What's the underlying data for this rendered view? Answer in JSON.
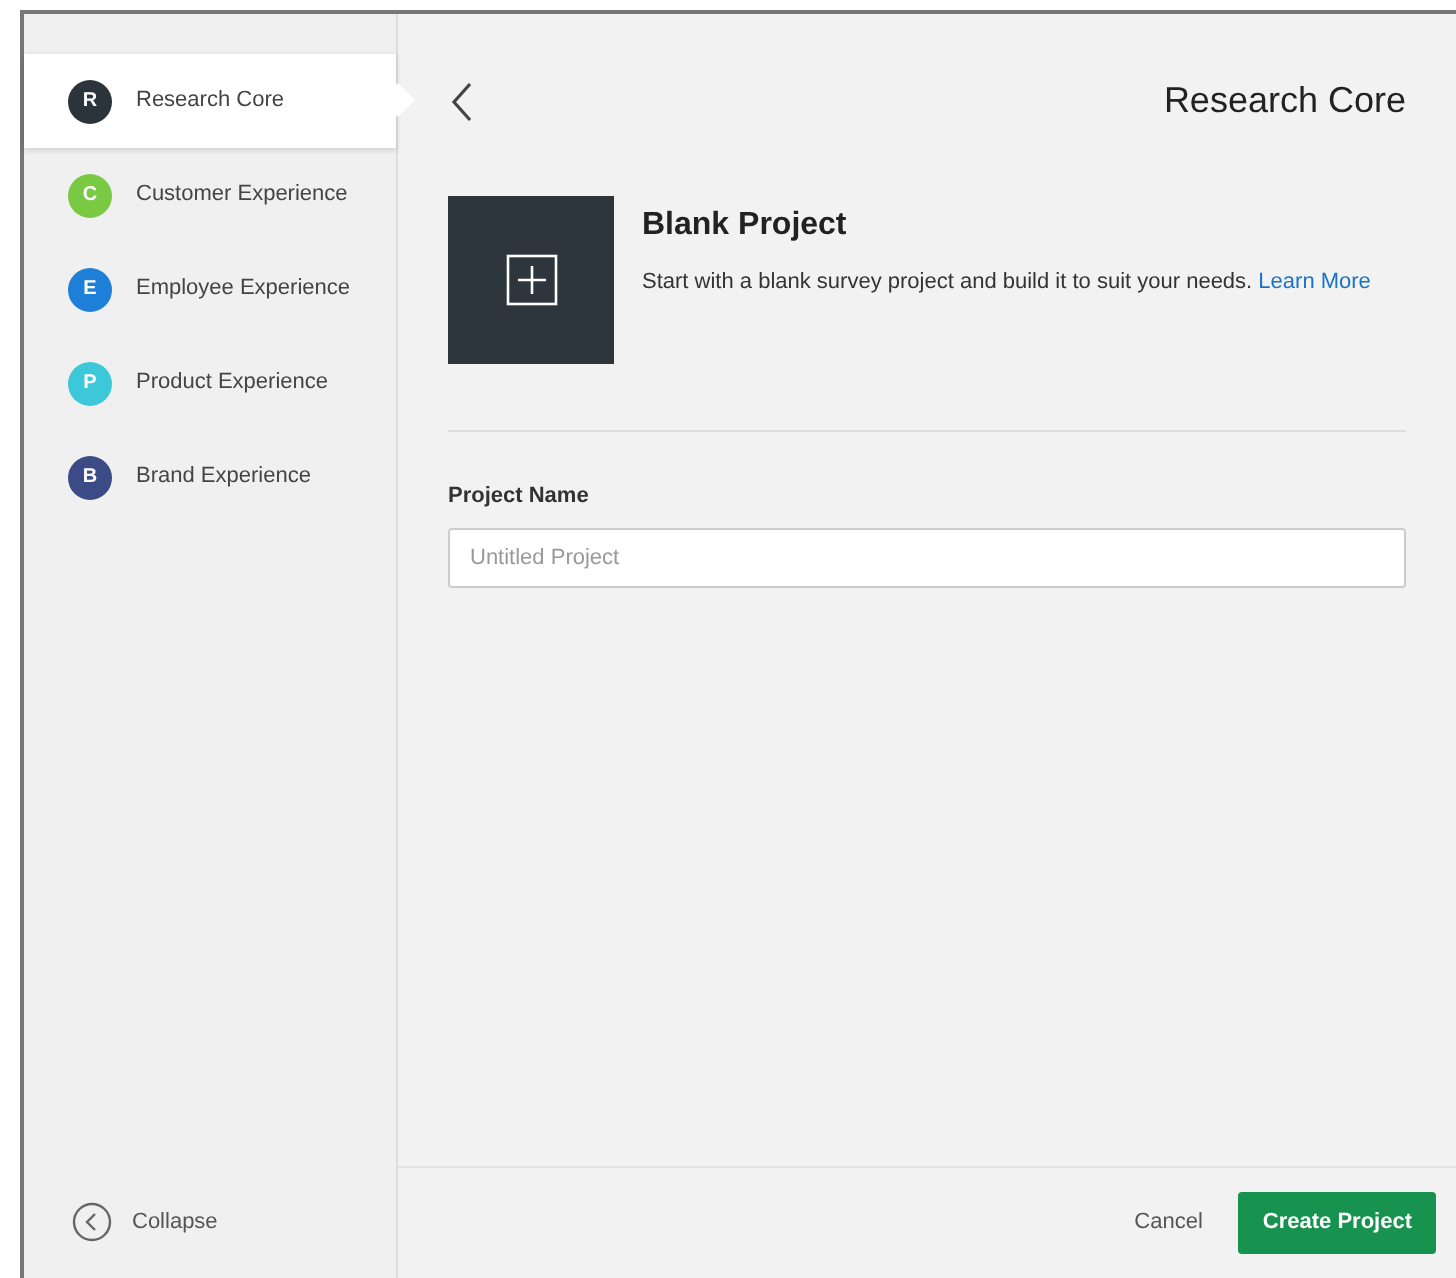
{
  "sidebar": {
    "items": [
      {
        "label": "Research Core",
        "letter": "R",
        "color": "#2b343a",
        "selected": true
      },
      {
        "label": "Customer Experience",
        "letter": "C",
        "color": "#7ac943",
        "selected": false
      },
      {
        "label": "Employee Experience",
        "letter": "E",
        "color": "#1e7fd8",
        "selected": false
      },
      {
        "label": "Product Experience",
        "letter": "P",
        "color": "#3cc8d8",
        "selected": false
      },
      {
        "label": "Brand Experience",
        "letter": "B",
        "color": "#3c4a85",
        "selected": false
      }
    ],
    "collapse": "Collapse"
  },
  "header": {
    "title": "Research Core"
  },
  "template": {
    "title": "Blank Project",
    "description": "Start with a blank survey project and build it to suit your needs.",
    "link": "Learn More"
  },
  "project_name": {
    "label": "Project Name",
    "placeholder": "Untitled Project"
  },
  "footer": {
    "cancel": "Cancel",
    "create": "Create Project"
  }
}
